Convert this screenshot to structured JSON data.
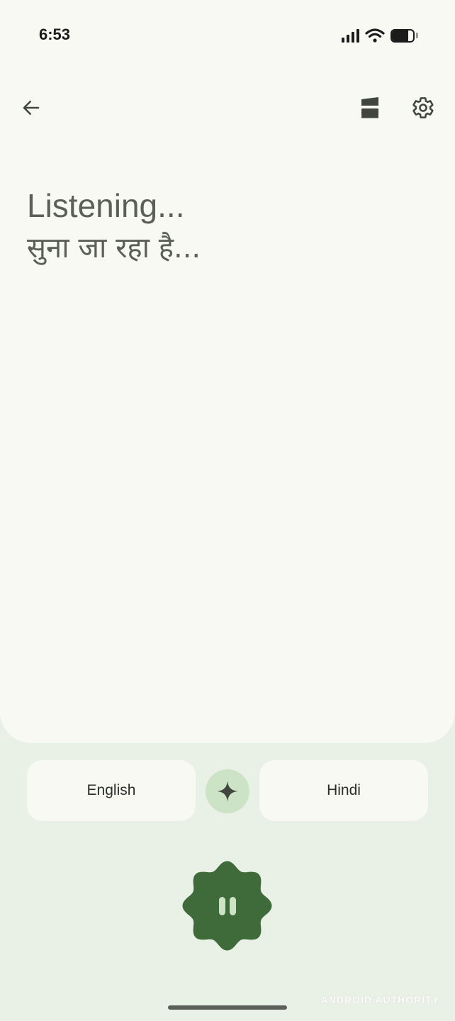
{
  "status_bar": {
    "time": "6:53",
    "battery_level_percent": 75,
    "icons": [
      "signal-icon",
      "wifi-icon",
      "battery-icon"
    ]
  },
  "toolbar": {
    "back_icon": "arrow-left-icon",
    "layout_icon": "split-screen-icon",
    "settings_icon": "gear-icon"
  },
  "transcript": {
    "source_text": "Listening...",
    "target_text": "सुना जा रहा है..."
  },
  "languages": {
    "source": "English",
    "target": "Hindi",
    "swap_icon": "sparkle-icon"
  },
  "controls": {
    "pause_icon": "pause-icon"
  },
  "watermark": "ANDROID AUTHORITY",
  "colors": {
    "background": "#e9f0e5",
    "panel": "#f8f9f3",
    "accent_dark": "#3f6b3a",
    "accent_light": "#cde3c6",
    "text_muted": "#5b5f58"
  }
}
